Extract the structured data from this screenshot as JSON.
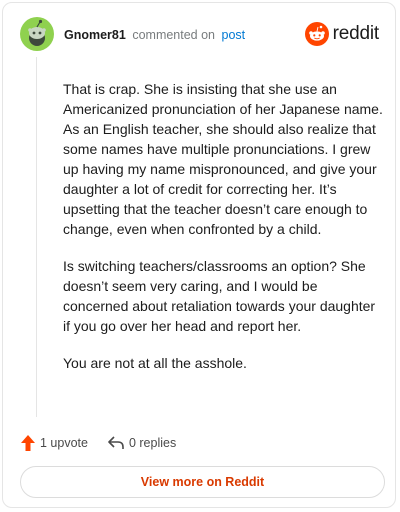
{
  "header": {
    "username": "Gnomer81",
    "action": "commented on",
    "link_text": "post",
    "brand": "reddit",
    "avatar_icon": "snoo-avatar-icon",
    "brand_icon": "reddit-logo-icon"
  },
  "comment": {
    "paragraphs": [
      "That is crap. She is insisting that she use an Americanized pronunciation of her Japanese name. As an English teacher, she should also realize that some names have multiple pronunciations. I grew up having my name mispronounced, and give your daughter a lot of credit for correcting her. It’s upsetting that the teacher doesn’t care enough to change, even when confronted by a child.",
      "Is switching teachers/classrooms an option? She doesn’t seem very caring, and I would be concerned about retaliation towards your daughter if you go over her head and report her.",
      "You are not at all the asshole."
    ]
  },
  "footer": {
    "upvotes": "1 upvote",
    "replies": "0 replies",
    "upvote_icon": "upvote-arrow-icon",
    "reply_icon": "reply-arrow-icon"
  },
  "cta": {
    "label": "View more on Reddit"
  },
  "colors": {
    "accent": "#d93a00",
    "link": "#0079d3",
    "avatar": "#8fd14f",
    "upvote": "#ff4500"
  }
}
